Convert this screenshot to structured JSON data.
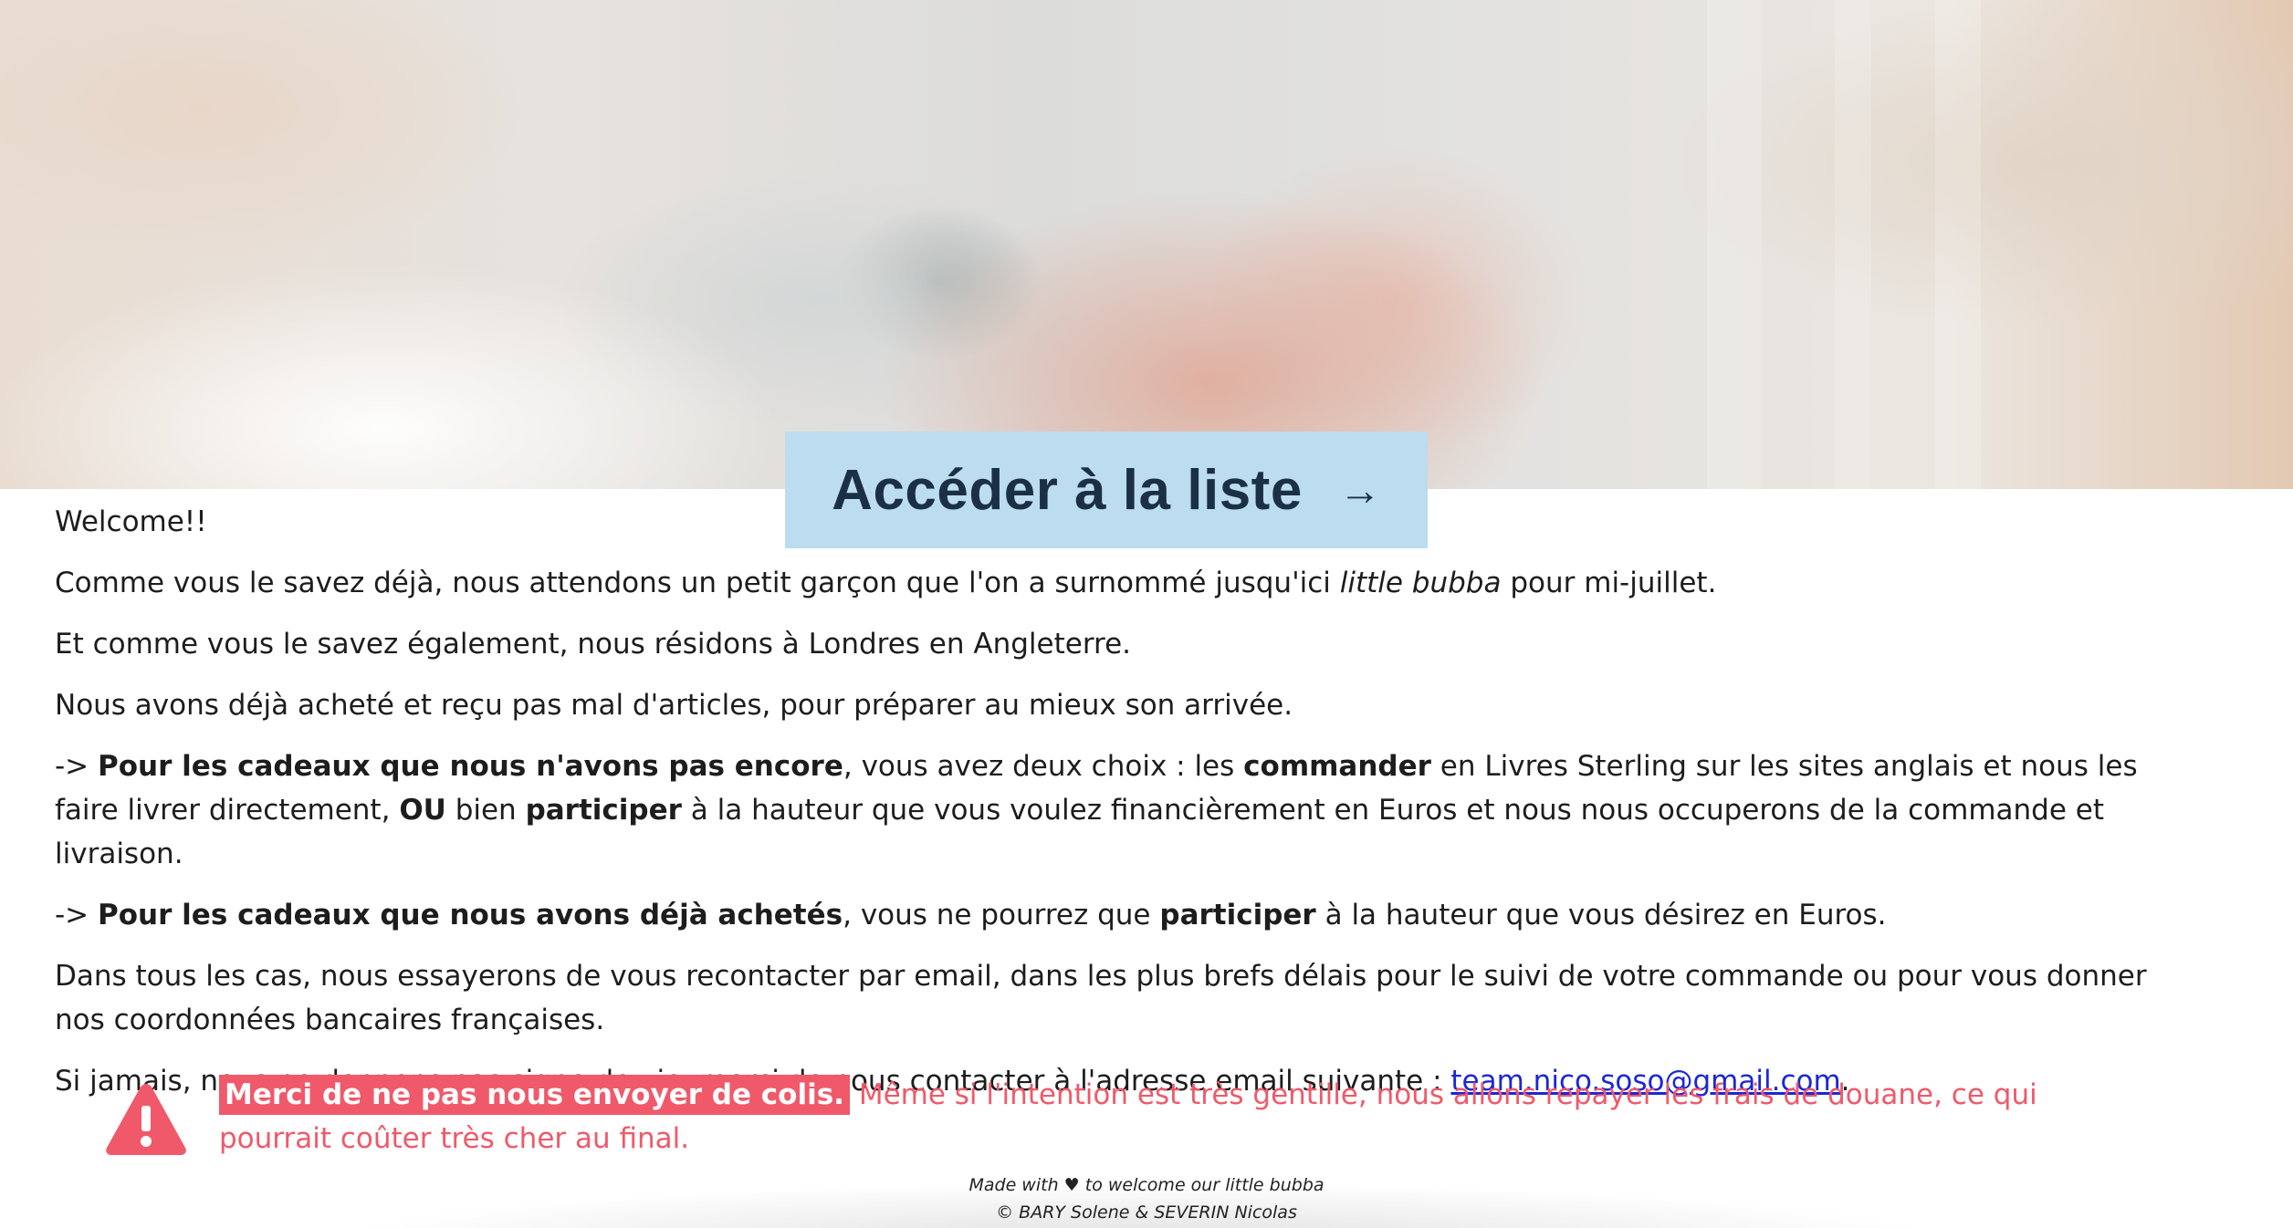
{
  "hero": {
    "button_label": "Accéder à la liste",
    "button_arrow": "→",
    "button_color": "#bcdcef"
  },
  "content": {
    "welcome": "Welcome!!",
    "p1_before": "Comme vous le savez déjà, nous attendons un petit garçon que l'on a surnommé jusqu'ici ",
    "p1_italic": "little bubba",
    "p1_after": " pour mi-juillet.",
    "p2": "Et comme vous le savez également, nous résidons à Londres en Angleterre.",
    "p3": "Nous avons déjà acheté et reçu pas mal d'articles, pour préparer au mieux son arrivée.",
    "p4_arrow": "-> ",
    "p4_bold1": "Pour les cadeaux que nous n'avons pas encore",
    "p4_text1": ", vous avez deux choix : les ",
    "p4_bold2": "commander",
    "p4_text2": " en Livres Sterling sur les sites anglais et nous les faire livrer directement, ",
    "p4_bold3": "OU",
    "p4_text3": " bien ",
    "p4_bold4": "participer",
    "p4_text4": " à la hauteur que vous voulez financièrement en Euros et nous nous occuperons de la commande et livraison.",
    "p5_arrow": "-> ",
    "p5_bold1": "Pour les cadeaux que nous avons déjà achetés",
    "p5_text1": ", vous ne pourrez que ",
    "p5_bold2": "participer",
    "p5_text2": " à la hauteur que vous désirez en Euros.",
    "p6": "Dans tous les cas, nous essayerons de vous recontacter par email, dans les plus brefs délais pour le suivi de votre commande ou pour vous donner nos coordonnées bancaires françaises.",
    "p7_before": "Si jamais, nous ne donnons pas signe de vie, merci de nous contacter à l'adresse email suivante : ",
    "p7_email": "team.nico.soso@gmail.com",
    "p7_after": "."
  },
  "warning": {
    "icon": "warning-triangle-icon",
    "highlight": "Merci de ne pas nous envoyer de colis.",
    "text": " Même si l'intention est très gentille, nous allons repayer les frais de douane, ce qui pourrait coûter très cher au final.",
    "color": "#f0596a"
  },
  "footer": {
    "line1_before": "Made with ",
    "heart": "♥",
    "line1_after": " to welcome our little bubba",
    "line2": "© BARY Solene & SEVERIN Nicolas"
  }
}
